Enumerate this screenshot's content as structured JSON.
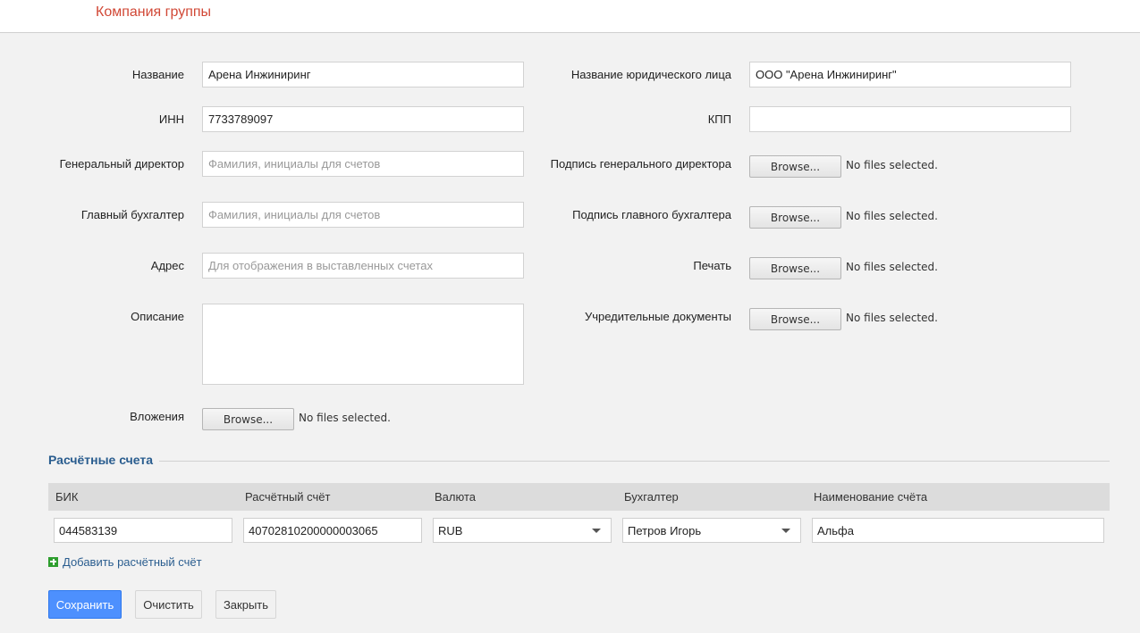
{
  "header": {
    "title": "Компания группы"
  },
  "form": {
    "name": {
      "label": "Название",
      "value": "Арена Инжиниринг"
    },
    "legal_name": {
      "label": "Название юридического лица",
      "value": "ООО \"Арена Инжиниринг\""
    },
    "inn": {
      "label": "ИНН",
      "value": "7733789097"
    },
    "kpp": {
      "label": "КПП",
      "value": ""
    },
    "director": {
      "label": "Генеральный директор",
      "placeholder": "Фамилия, инициалы для счетов"
    },
    "director_signature": {
      "label": "Подпись генерального директора",
      "button": "Browse...",
      "status": "No files selected."
    },
    "accountant": {
      "label": "Главный бухгалтер",
      "placeholder": "Фамилия, инициалы для счетов"
    },
    "accountant_signature": {
      "label": "Подпись главного бухгалтера",
      "button": "Browse...",
      "status": "No files selected."
    },
    "address": {
      "label": "Адрес",
      "placeholder": "Для отображения в выставленных счетах"
    },
    "stamp": {
      "label": "Печать",
      "button": "Browse...",
      "status": "No files selected."
    },
    "description": {
      "label": "Описание",
      "value": ""
    },
    "founding_docs": {
      "label": "Учредительные документы",
      "button": "Browse...",
      "status": "No files selected."
    },
    "attachments": {
      "label": "Вложения",
      "button": "Browse...",
      "status": "No files selected."
    }
  },
  "accounts": {
    "title": "Расчётные счета",
    "columns": [
      "БИК",
      "Расчётный счёт",
      "Валюта",
      "Бухгалтер",
      "Наименование счёта"
    ],
    "rows": [
      {
        "bik": "044583139",
        "account": "40702810200000003065",
        "currency": "RUB",
        "accountant": "Петров Игорь",
        "account_name": "Альфа"
      }
    ],
    "add_label": "Добавить расчётный счёт"
  },
  "actions": {
    "save": "Сохранить",
    "clear": "Очистить",
    "close": "Закрыть"
  },
  "colors": {
    "title": "#d14836",
    "link": "#2a5d8f",
    "primary": "#4d90fe",
    "add_icon": "#2e9e2e"
  }
}
